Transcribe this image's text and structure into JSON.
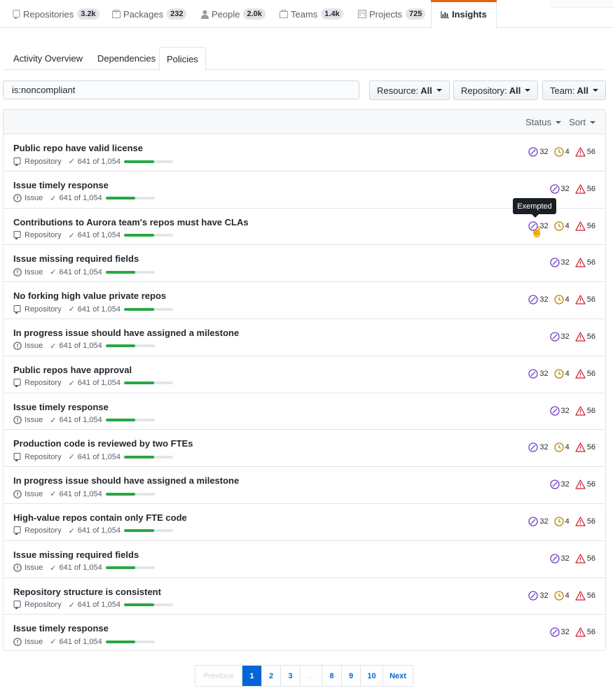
{
  "top_tabs": [
    {
      "label": "Repositories",
      "count": "3.2k",
      "icon": "repo-icon"
    },
    {
      "label": "Packages",
      "count": "232",
      "icon": "package-icon"
    },
    {
      "label": "People",
      "count": "2.0k",
      "icon": "person-icon"
    },
    {
      "label": "Teams",
      "count": "1.4k",
      "icon": "team-icon"
    },
    {
      "label": "Projects",
      "count": "725",
      "icon": "project-icon"
    },
    {
      "label": "Insights",
      "count": "",
      "icon": "graph-icon",
      "active": true
    }
  ],
  "sub_tabs": [
    {
      "label": "Activity Overview"
    },
    {
      "label": "Dependencies"
    },
    {
      "label": "Policies",
      "active": true
    }
  ],
  "search": {
    "value": "is:noncompliant"
  },
  "filters": [
    {
      "label": "Resource:",
      "value": "All"
    },
    {
      "label": "Repository:",
      "value": "All"
    },
    {
      "label": "Team:",
      "value": "All"
    }
  ],
  "list_header": {
    "status_label": "Status",
    "sort_label": "Sort"
  },
  "colors": {
    "exempt": "#6f42c1",
    "pending": "#b08800",
    "alert": "#cb2431",
    "progress": "#28a745",
    "accent": "#e36209"
  },
  "tooltip": "Exempted",
  "policies": [
    {
      "title": "Public repo have valid license",
      "type": "Repository",
      "progress_text": "641 of 1,054",
      "progress": 0.608,
      "exempt": "32",
      "pending": "4",
      "alerts": "56"
    },
    {
      "title": "Issue timely response",
      "type": "Issue",
      "progress_text": "641 of 1,054",
      "progress": 0.608,
      "exempt": "32",
      "pending": "",
      "alerts": "56"
    },
    {
      "title": "Contributions to Aurora team's repos must have CLAs",
      "type": "Repository",
      "progress_text": "641 of 1,054",
      "progress": 0.608,
      "exempt": "32",
      "pending": "4",
      "alerts": "56"
    },
    {
      "title": "Issue missing required fields",
      "type": "Issue",
      "progress_text": "641 of 1,054",
      "progress": 0.608,
      "exempt": "32",
      "pending": "",
      "alerts": "56"
    },
    {
      "title": "No forking high value private repos",
      "type": "Repository",
      "progress_text": "641 of 1,054",
      "progress": 0.608,
      "exempt": "32",
      "pending": "4",
      "alerts": "56"
    },
    {
      "title": "In progress issue should have assigned a milestone",
      "type": "Issue",
      "progress_text": "641 of 1,054",
      "progress": 0.608,
      "exempt": "32",
      "pending": "",
      "alerts": "56"
    },
    {
      "title": "Public repos have approval",
      "type": "Repository",
      "progress_text": "641 of 1,054",
      "progress": 0.608,
      "exempt": "32",
      "pending": "4",
      "alerts": "56"
    },
    {
      "title": "Issue timely response",
      "type": "Issue",
      "progress_text": "641 of 1,054",
      "progress": 0.608,
      "exempt": "32",
      "pending": "",
      "alerts": "56"
    },
    {
      "title": "Production code is reviewed by two FTEs",
      "type": "Repository",
      "progress_text": "641 of 1,054",
      "progress": 0.608,
      "exempt": "32",
      "pending": "4",
      "alerts": "56"
    },
    {
      "title": "In progress issue should have assigned a milestone",
      "type": "Issue",
      "progress_text": "641 of 1,054",
      "progress": 0.608,
      "exempt": "32",
      "pending": "",
      "alerts": "56"
    },
    {
      "title": "High-value repos contain only FTE code",
      "type": "Repository",
      "progress_text": "641 of 1,054",
      "progress": 0.608,
      "exempt": "32",
      "pending": "4",
      "alerts": "56"
    },
    {
      "title": "Issue missing required fields",
      "type": "Issue",
      "progress_text": "641 of 1,054",
      "progress": 0.608,
      "exempt": "32",
      "pending": "",
      "alerts": "56"
    },
    {
      "title": "Repository structure is consistent",
      "type": "Repository",
      "progress_text": "641 of 1,054",
      "progress": 0.608,
      "exempt": "32",
      "pending": "4",
      "alerts": "56"
    },
    {
      "title": "Issue timely response",
      "type": "Issue",
      "progress_text": "641 of 1,054",
      "progress": 0.608,
      "exempt": "32",
      "pending": "",
      "alerts": "56"
    }
  ],
  "pagination": {
    "previous": "Previous",
    "next": "Next",
    "pages": [
      "1",
      "2",
      "3",
      "…",
      "8",
      "9",
      "10"
    ],
    "current": "1"
  }
}
